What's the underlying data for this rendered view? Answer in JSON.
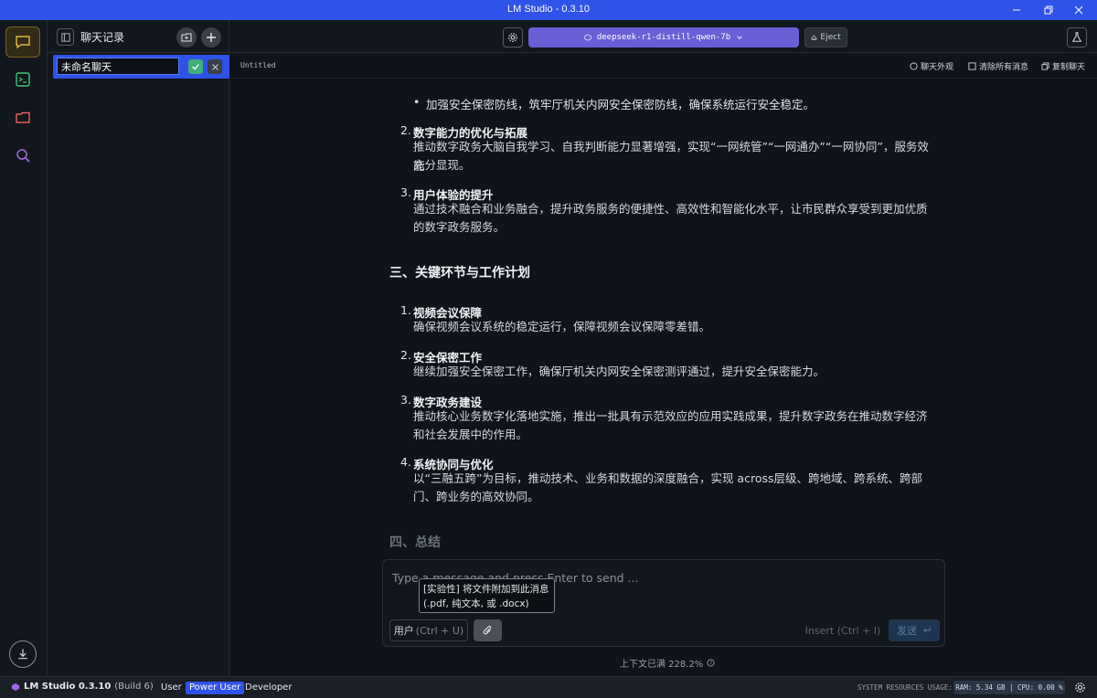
{
  "window": {
    "title": "LM Studio - 0.3.10"
  },
  "sidebar": {
    "title": "聊天记录",
    "chat_name_value": "未命名聊天"
  },
  "topbar": {
    "model_name": "deepseek-r1-distill-qwen-7b",
    "eject_label": "Eject"
  },
  "subbar": {
    "chat_title": "Untitled",
    "actions": [
      "聊天外观",
      "清除所有消息",
      "复制聊天"
    ]
  },
  "content": {
    "partial_bullet": "加强安全保密防线，筑牢厅机关内网安全保密防线，确保系统运行安全稳定。",
    "section2_items": [
      {
        "num": "2.",
        "title": "数字能力的优化与拓展",
        "lines": [
          "推动数字政务大脑自我学习、自我判断能力显著增强，实现“一网统管”“一网通办”“一网协同”，服务效能",
          "充分显现。"
        ]
      },
      {
        "num": "3.",
        "title": "用户体验的提升",
        "lines": [
          "通过技术融合和业务融合，提升政务服务的便捷性、高效性和智能化水平，让市民群众享受到更加优质",
          "的数字政务服务。"
        ]
      }
    ],
    "section3_heading": "三、关键环节与工作计划",
    "section3_items": [
      {
        "num": "1.",
        "title": "视频会议保障",
        "lines": [
          "确保视频会议系统的稳定运行，保障视频会议保障零差错。"
        ]
      },
      {
        "num": "2.",
        "title": "安全保密工作",
        "lines": [
          "继续加强安全保密工作，确保厅机关内网安全保密测评通过，提升安全保密能力。"
        ]
      },
      {
        "num": "3.",
        "title": "数字政务建设",
        "lines": [
          "推动核心业务数字化落地实施，推出一批具有示范效应的应用实践成果，提升数字政务在推动数字经济",
          "和社会发展中的作用。"
        ]
      },
      {
        "num": "4.",
        "title": "系统协同与优化",
        "lines": [
          "以“三融五跨”为目标，推动技术、业务和数据的深度融合，实现 across层级、跨地域、跨系统、跨部",
          "门、跨业务的高效协同。"
        ]
      }
    ],
    "section4_heading": "四、总结"
  },
  "composer": {
    "placeholder": "Type a message and press Enter to send ...",
    "role_label": "用户",
    "role_hint": "(Ctrl + U)",
    "insert_label": "Insert (Ctrl + I)",
    "send_label": "发送",
    "tooltip_line1": "[实验性] 将文件附加到此消息",
    "tooltip_line2": "(.pdf, 纯文本, 或 .docx)",
    "context_text": "上下文已满 228.2%"
  },
  "statusbar": {
    "app_name": "LM Studio 0.3.10",
    "build": "(Build 6)",
    "modes": [
      "User",
      "Power User",
      "Developer"
    ],
    "active_mode": "Power User",
    "sys_label": "SYSTEM RESOURCES USAGE:",
    "sys_value": "RAM: 5.34 GB | CPU: 0.00 %"
  },
  "colors": {
    "accent": "#2f52e8",
    "model": "#6a5fd6",
    "rail_active": "#e0b43c"
  }
}
